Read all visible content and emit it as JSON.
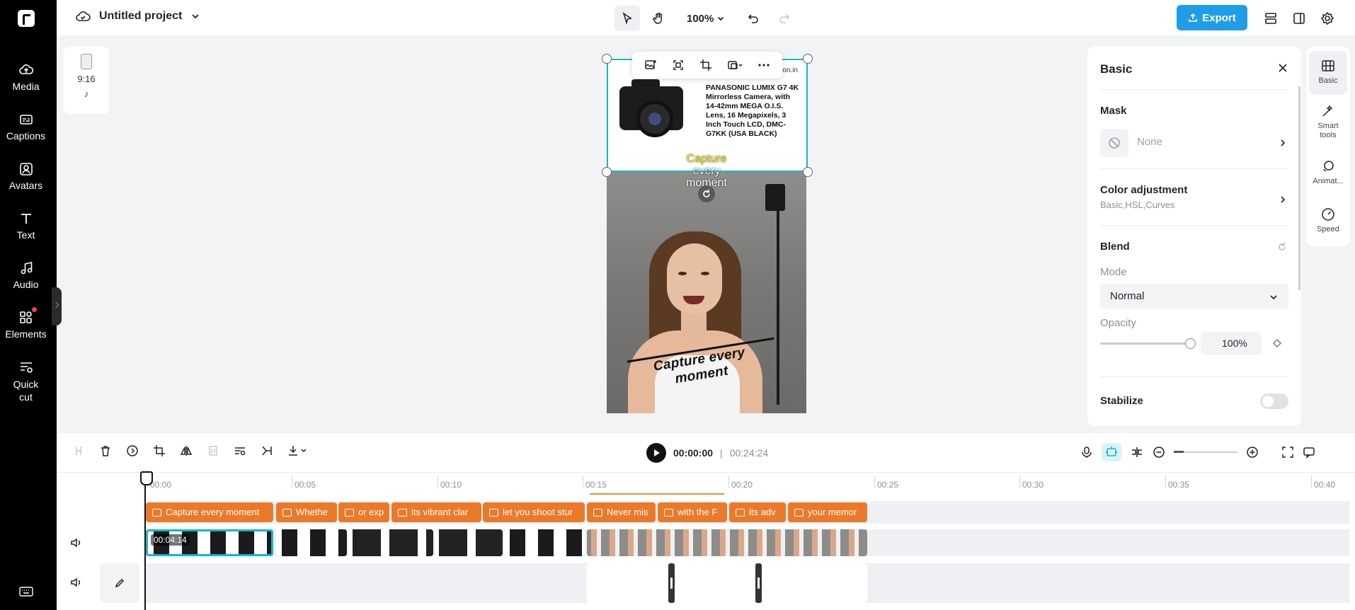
{
  "app": {
    "project_title": "Untitled project",
    "zoom_level": "100%",
    "export_label": "Export"
  },
  "sidebar": {
    "items": [
      {
        "label": "Media",
        "icon": "media-cloud-icon"
      },
      {
        "label": "Captions",
        "icon": "captions-icon"
      },
      {
        "label": "Avatars",
        "icon": "avatar-icon"
      },
      {
        "label": "Text",
        "icon": "text-icon"
      },
      {
        "label": "Audio",
        "icon": "music-note-icon"
      },
      {
        "label": "Elements",
        "icon": "elements-icon",
        "badge": true
      },
      {
        "label": "Quick cut",
        "icon": "quick-cut-icon"
      }
    ]
  },
  "aspect": {
    "ratio": "9:16"
  },
  "canvas": {
    "product_url": "on.in",
    "product_title": "PANASONIC LUMIX G7 4K Mirrorless Camera, with 14-42mm MEGA O.I.S. Lens, 16 Megapixels, 3 Inch Touch LCD, DMC-G7KK (USA BLACK)",
    "caption_line1": "Capture",
    "caption_line2": "every",
    "caption_line3": "moment",
    "banner_text": "Capture every moment"
  },
  "panel": {
    "title": "Basic",
    "mask_title": "Mask",
    "mask_value": "None",
    "color_title": "Color adjustment",
    "color_sub": "Basic,HSL,Curves",
    "blend_title": "Blend",
    "mode_label": "Mode",
    "mode_value": "Normal",
    "opacity_label": "Opacity",
    "opacity_value": "100%",
    "opacity_fraction": 1.0,
    "stabilize_label": "Stabilize",
    "stabilize_on": false
  },
  "side_tabs": [
    {
      "label": "Basic",
      "active": true
    },
    {
      "label": "Smart tools",
      "active": false
    },
    {
      "label": "Animat...",
      "active": false
    },
    {
      "label": "Speed",
      "active": false
    }
  ],
  "playback": {
    "current_time": "00:00:00",
    "total_time": "00:24:24",
    "separator": "|"
  },
  "timeline": {
    "ruler": [
      "00:00",
      "00:05",
      "00:10",
      "00:15",
      "00:20",
      "00:25",
      "00:30",
      "00:35",
      "00:40"
    ],
    "captions": [
      "Capture every moment",
      "Whethe",
      "or exp",
      "its vibrant clar",
      "let you shoot stur",
      "Never mis",
      "with the F",
      "its adv",
      "your memor"
    ],
    "selected_clip_duration": "00:04:14"
  },
  "colors": {
    "accent": "#16b5c9",
    "export": "#1f9de8",
    "caption_clip": "#ea7a2a"
  }
}
